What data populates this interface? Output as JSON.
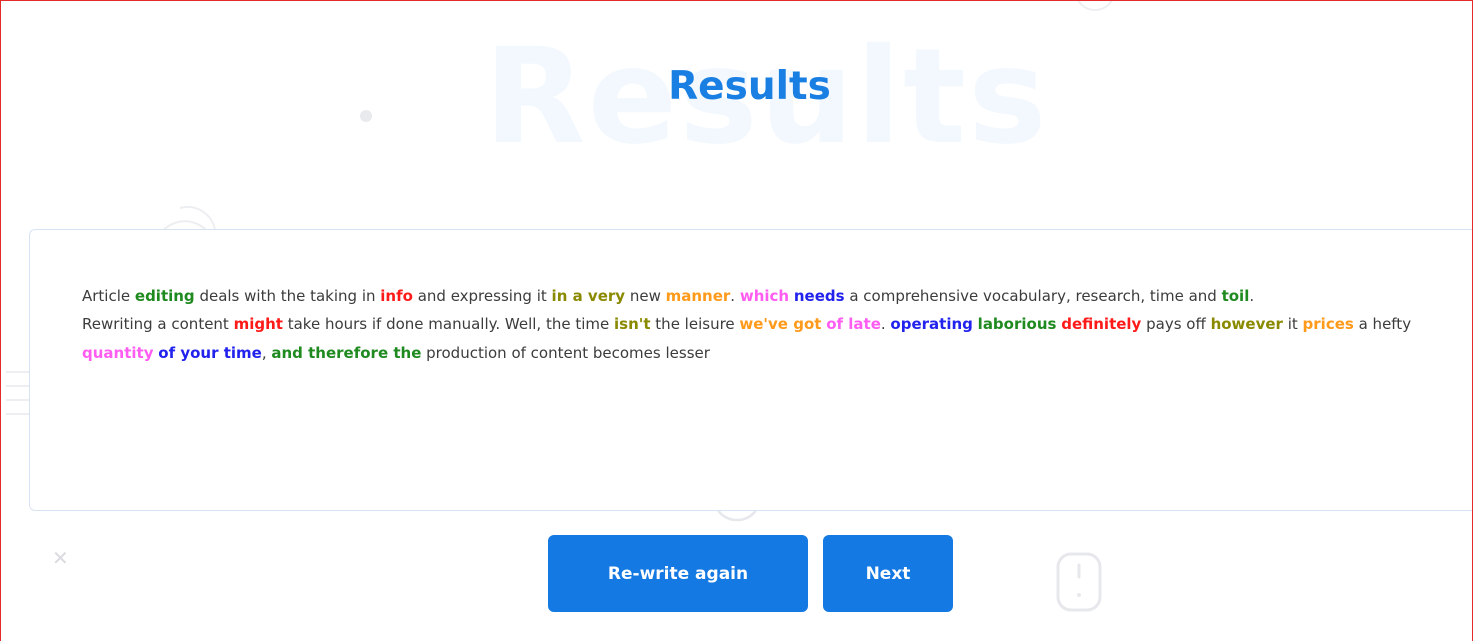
{
  "page": {
    "background_word": "Results",
    "title": "Results"
  },
  "result": {
    "paragraphs": [
      [
        {
          "text": "Article ",
          "color": null
        },
        {
          "text": "editing",
          "color": "#1f8a1f"
        },
        {
          "text": " deals with the taking in ",
          "color": null
        },
        {
          "text": "info",
          "color": "#ff1a1a"
        },
        {
          "text": " and expressing it ",
          "color": null
        },
        {
          "text": "in a very",
          "color": "#8a8a00"
        },
        {
          "text": " new ",
          "color": null
        },
        {
          "text": "manner",
          "color": "#ff9a1a"
        },
        {
          "text": ". ",
          "color": null
        },
        {
          "text": "which",
          "color": "#ff5cf2"
        },
        {
          "text": " ",
          "color": null
        },
        {
          "text": "needs",
          "color": "#2222ee"
        },
        {
          "text": " a comprehensive vocabulary, research, time and ",
          "color": null
        },
        {
          "text": "toil",
          "color": "#1f8a1f"
        },
        {
          "text": ".",
          "color": null
        }
      ],
      [
        {
          "text": "Rewriting a content ",
          "color": null
        },
        {
          "text": "might",
          "color": "#ff1a1a"
        },
        {
          "text": " take hours if done manually. Well, the time ",
          "color": null
        },
        {
          "text": "isn't",
          "color": "#8a8a00"
        },
        {
          "text": " the leisure ",
          "color": null
        },
        {
          "text": "we've got",
          "color": "#ff9a1a"
        },
        {
          "text": " ",
          "color": null
        },
        {
          "text": "of late",
          "color": "#ff5cf2"
        },
        {
          "text": ". ",
          "color": null
        },
        {
          "text": "operating",
          "color": "#2222ee"
        },
        {
          "text": " ",
          "color": null
        },
        {
          "text": "laborious",
          "color": "#1f8a1f"
        },
        {
          "text": " ",
          "color": null
        },
        {
          "text": "definitely",
          "color": "#ff1a1a"
        },
        {
          "text": " pays off ",
          "color": null
        },
        {
          "text": "however",
          "color": "#8a8a00"
        },
        {
          "text": " it ",
          "color": null
        },
        {
          "text": "prices",
          "color": "#ff9a1a"
        },
        {
          "text": " a hefty ",
          "color": null
        },
        {
          "text": "quantity",
          "color": "#ff5cf2"
        },
        {
          "text": " ",
          "color": null
        },
        {
          "text": "of your time",
          "color": "#2222ee"
        },
        {
          "text": ", ",
          "color": null
        },
        {
          "text": "and therefore the",
          "color": "#1f8a1f"
        },
        {
          "text": " production of content becomes lesser",
          "color": null
        }
      ]
    ]
  },
  "actions": {
    "rewrite_label": "Re-write again",
    "next_label": "Next"
  },
  "theme": {
    "accent": "#1479e2",
    "title_color": "#1a7fe3",
    "frame_border": "#e32b2b"
  },
  "icons": [
    "close-icon",
    "mouse-icon",
    "dot-decoration",
    "half-circle-decoration",
    "lines-decoration"
  ]
}
